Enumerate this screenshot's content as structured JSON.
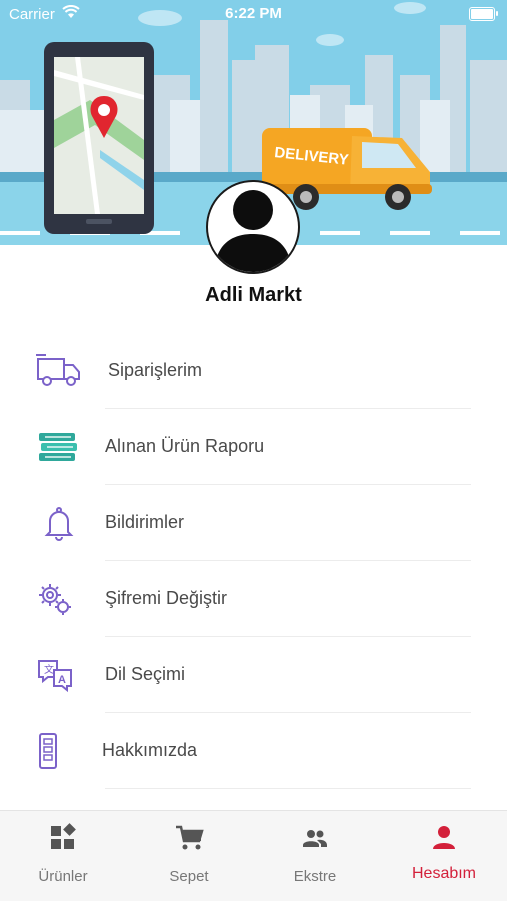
{
  "status_bar": {
    "carrier": "Carrier",
    "time": "6:22 PM"
  },
  "banner": {
    "van_text": "DELIVERY"
  },
  "profile": {
    "name": "Adli Markt"
  },
  "menu": {
    "items": [
      {
        "label": "Siparişlerim",
        "icon": "delivery-truck-icon"
      },
      {
        "label": "Alınan Ürün Raporu",
        "icon": "stacked-books-icon"
      },
      {
        "label": "Bildirimler",
        "icon": "bell-icon"
      },
      {
        "label": "Şifremi Değiştir",
        "icon": "gears-icon"
      },
      {
        "label": "Dil Seçimi",
        "icon": "translate-icon"
      },
      {
        "label": "Hakkımızda",
        "icon": "document-icon"
      }
    ]
  },
  "tabbar": {
    "tabs": [
      {
        "label": "Ürünler",
        "icon": "products-grid-icon"
      },
      {
        "label": "Sepet",
        "icon": "cart-icon"
      },
      {
        "label": "Ekstre",
        "icon": "people-icon"
      },
      {
        "label": "Hesabım",
        "icon": "person-icon"
      }
    ],
    "active_index": 3
  },
  "colors": {
    "accent": "#d3203a",
    "menu_icon_purple": "#7b62c9",
    "menu_icon_teal": "#2fa89b",
    "banner_sky": "#82cfe9",
    "van": "#f5a623"
  }
}
